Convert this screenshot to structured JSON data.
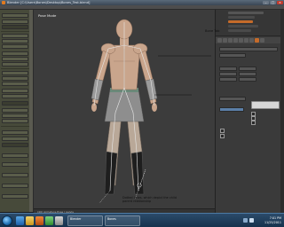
{
  "window": {
    "title": "Blender [C:\\Users\\Bones\\Desktop\\Bones_Test.blend]",
    "controls": {
      "minimize": "–",
      "maximize": "□",
      "close": "×"
    }
  },
  "viewport": {
    "label": "Pose Mode",
    "footer_hint": "(40) Armature-Pose | pelvis",
    "annotations": {
      "right": "Bone Tab",
      "bottom": "Dotted Lines, which depict the child\nparent relationship"
    }
  },
  "taskbar": {
    "tasks": [
      {
        "label": "Blender"
      },
      {
        "label": "Bones"
      }
    ],
    "clock_time": "7:01 PM",
    "clock_date": "11/25/2011"
  },
  "colors": {
    "accent_orange": "#c56b2a",
    "panel_bg": "#3a3a3a",
    "viewport_bg": "#3c3c3c",
    "taskbar": "#1d3d5c"
  },
  "icons": [
    "blender-app-icon",
    "start-orb-icon",
    "ie-icon",
    "explorer-icon",
    "media-icon",
    "network-icon",
    "volume-icon"
  ]
}
